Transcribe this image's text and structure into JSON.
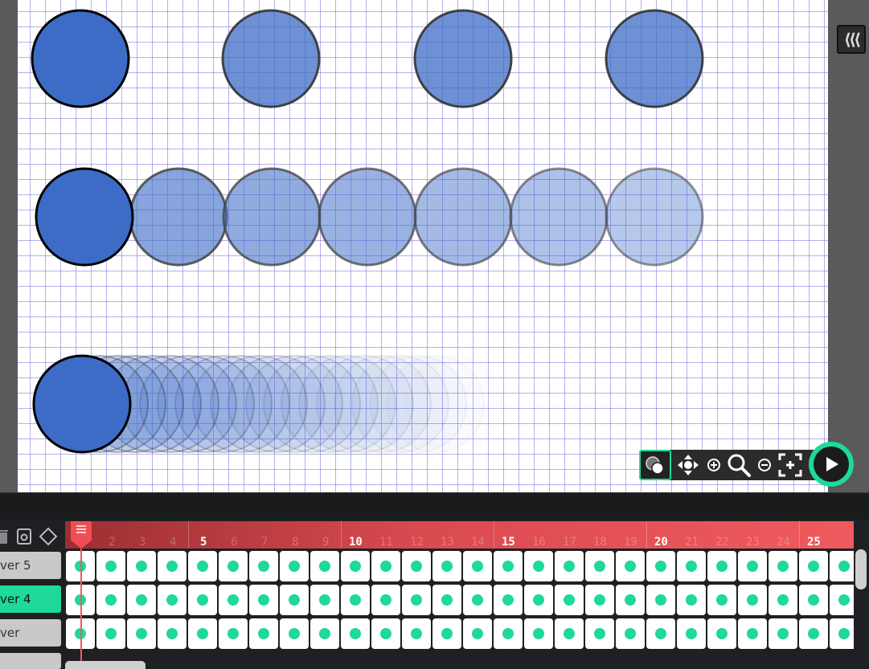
{
  "colors": {
    "accent": "#1fd99a",
    "timeline_red": "#f05a5e",
    "circle_fill": "#3d6cc7",
    "canvas_grid": "#7e74dc"
  },
  "icons": {
    "collapse": "triple-chevron-left-icon",
    "onion_skin": "onion-skin-icon",
    "move": "move-arrows-icon",
    "zoom_in": "zoom-in-icon",
    "zoom": "magnifier-icon",
    "zoom_out": "zoom-out-icon",
    "fit": "fit-screen-icon",
    "play": "play-icon",
    "trash": "trash-icon",
    "snapshot": "snapshot-icon",
    "keyframe": "keyframe-diamond-icon"
  },
  "canvas_rows": {
    "row1_circles": 4,
    "row2_circles": 7,
    "row3_ghosts": 22
  },
  "timeline": {
    "major_ticks": [
      "5",
      "10",
      "15",
      "20",
      "25"
    ],
    "minor_ticks": [
      "2",
      "3",
      "4",
      "6",
      "7",
      "8",
      "9",
      "11",
      "12",
      "13",
      "14",
      "16",
      "17",
      "18",
      "19",
      "21",
      "22",
      "23",
      "24"
    ],
    "layers": [
      {
        "label": "ver 5",
        "active": false
      },
      {
        "label": "ver 4",
        "active": true
      },
      {
        "label": "ver",
        "active": false
      }
    ],
    "visible_frames": 26
  }
}
